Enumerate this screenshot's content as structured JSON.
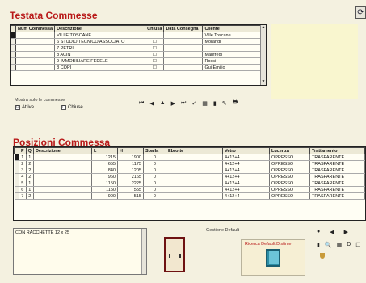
{
  "commesse": {
    "title": "Testata Commesse",
    "columns": [
      "Num Commessa",
      "Descrizione",
      "Chiusa",
      "Data Consegna",
      "Cliente"
    ],
    "rows": [
      {
        "num": "",
        "desc": "VILLE TOSCANE",
        "chiusa": "",
        "data": "",
        "cliente": "Ville Toscane"
      },
      {
        "num": "",
        "desc": "6 STUDIO TECNICO ASSOCIATO",
        "chiusa": "☐",
        "data": "",
        "cliente": "Morandi"
      },
      {
        "num": "",
        "desc": "7 PETRI",
        "chiusa": "☐",
        "data": "",
        "cliente": ""
      },
      {
        "num": "",
        "desc": "8 ACIN",
        "chiusa": "☐",
        "data": "",
        "cliente": "Manfredi"
      },
      {
        "num": "",
        "desc": "9 IMMOBILIARE FEDELE",
        "chiusa": "☐",
        "data": "",
        "cliente": "Rossi"
      },
      {
        "num": "",
        "desc": "8 COPI",
        "chiusa": "☐",
        "data": "",
        "cliente": "Gui Emilio"
      }
    ],
    "filter_label": "Mostra solo le commesse",
    "attive_label": "Attive",
    "chiuse_label": "Chiuse",
    "attive_checked": "☑",
    "chiuse_checked": "☐"
  },
  "navbar": {
    "buttons": [
      "⏮",
      "◀",
      "▲",
      "▶",
      "⏭",
      "✓",
      "▦",
      "▮",
      "✎",
      "🖶"
    ]
  },
  "posizioni": {
    "title": "Posizioni Commessa",
    "columns": [
      "P",
      "Q",
      "Descrizione",
      "L",
      "H",
      "Spalla",
      "Ebrotte",
      "Vetro",
      "Lucenza",
      "Trattamento"
    ],
    "rows": [
      {
        "p": "1",
        "q": "1",
        "desc": "",
        "l": "1215",
        "h": "1900",
        "spalla": "0",
        "ebrotte": "",
        "vetro": "4+12+4",
        "luc": "OPRESSO",
        "tratt": "TRASPARENTE"
      },
      {
        "p": "2",
        "q": "2",
        "desc": "",
        "l": "655",
        "h": "1175",
        "spalla": "0",
        "ebrotte": "",
        "vetro": "4+12+4",
        "luc": "OPRESSO",
        "tratt": "TRASPARENTE"
      },
      {
        "p": "3",
        "q": "2",
        "desc": "",
        "l": "840",
        "h": "1205",
        "spalla": "0",
        "ebrotte": "",
        "vetro": "4+12+4",
        "luc": "OPRESSO",
        "tratt": "TRASPARENTE"
      },
      {
        "p": "4",
        "q": "2",
        "desc": "",
        "l": "960",
        "h": "2165",
        "spalla": "0",
        "ebrotte": "",
        "vetro": "4+12+4",
        "luc": "OPRESSO",
        "tratt": "TRASPARENTE"
      },
      {
        "p": "5",
        "q": "1",
        "desc": "",
        "l": "1150",
        "h": "2225",
        "spalla": "0",
        "ebrotte": "",
        "vetro": "4+12+4",
        "luc": "OPRESSO",
        "tratt": "TRASPARENTE"
      },
      {
        "p": "6",
        "q": "1",
        "desc": "",
        "l": "1150",
        "h": "555",
        "spalla": "0",
        "ebrotte": "",
        "vetro": "4+12+4",
        "luc": "OPRESSO",
        "tratt": "TRASPARENTE"
      },
      {
        "p": "7",
        "q": "2",
        "desc": "",
        "l": "900",
        "h": "515",
        "spalla": "0",
        "ebrotte": "",
        "vetro": "4+12+4",
        "luc": "OPRESSO",
        "tratt": "TRASPARENTE"
      }
    ]
  },
  "note": {
    "text": "CON RACCHETTE 12 x 25"
  },
  "gestione": {
    "label": "Gestione Default",
    "button_label": "Ricerca Default Distinte"
  },
  "tools": {
    "row1": [
      "●",
      "◀",
      "▶"
    ],
    "row2": [
      "▮",
      "🔍",
      "▦",
      "D",
      "☐"
    ]
  },
  "colors": {
    "accent": "#b81818",
    "background": "#f4f1e0",
    "panel": "#f9f6cf"
  }
}
